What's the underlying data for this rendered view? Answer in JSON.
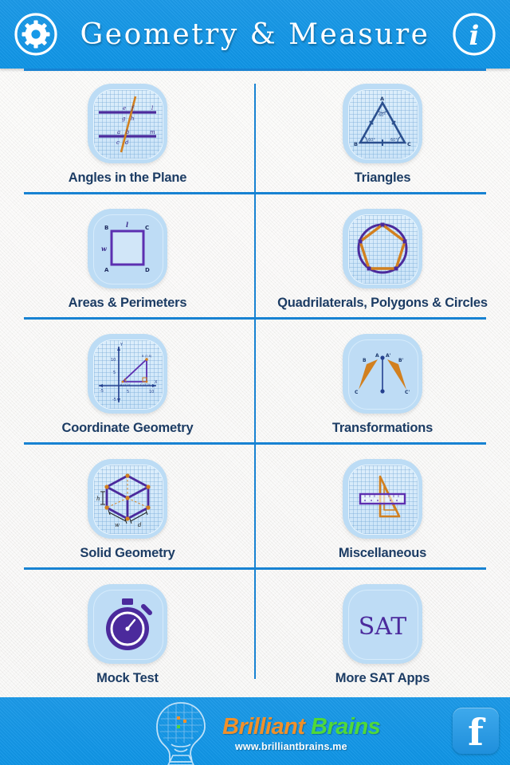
{
  "header": {
    "title": "Geometry  &  Measure",
    "settings_icon": "gear-icon",
    "info_icon": "info-icon"
  },
  "grid": {
    "items": [
      {
        "label": "Angles in the Plane",
        "icon": "parallel-lines-transversal-icon",
        "diagram_labels": [
          "e",
          "f",
          "g",
          "h",
          "a",
          "b",
          "c",
          "d",
          "l",
          "m"
        ]
      },
      {
        "label": "Triangles",
        "icon": "equilateral-triangle-icon",
        "diagram_labels": [
          "A",
          "B",
          "C",
          "60°",
          "60°",
          "60°"
        ]
      },
      {
        "label": "Areas & Perimeters",
        "icon": "rectangle-area-icon",
        "diagram_labels": [
          "A",
          "B",
          "C",
          "D",
          "l",
          "w"
        ]
      },
      {
        "label": "Quadrilaterals, Polygons & Circles",
        "icon": "pentagon-in-circle-icon",
        "diagram_labels": []
      },
      {
        "label": "Coordinate Geometry",
        "icon": "coordinate-plane-triangle-icon",
        "diagram_labels": [
          "X",
          "Y",
          "10",
          "5",
          "-5",
          "-5",
          "5",
          "10",
          "A (1,2)",
          "B (7,8)",
          "C (7,2)"
        ]
      },
      {
        "label": "Transformations",
        "icon": "reflection-triangles-icon",
        "diagram_labels": [
          "A",
          "B",
          "C",
          "A'",
          "B'",
          "C'"
        ]
      },
      {
        "label": "Solid Geometry",
        "icon": "cube-box-icon",
        "diagram_labels": [
          "h",
          "w",
          "d"
        ]
      },
      {
        "label": "Miscellaneous",
        "icon": "ruler-set-square-icon",
        "diagram_labels": []
      },
      {
        "label": "Mock Test",
        "icon": "stopwatch-icon",
        "diagram_labels": []
      },
      {
        "label": "More SAT Apps",
        "icon": "sat-text-icon",
        "diagram_labels": [
          "SAT"
        ]
      }
    ]
  },
  "footer": {
    "brand_word1": "Brilliant",
    "brand_word2": "Brains",
    "url": "www.brilliantbrains.me",
    "brand_icon": "brain-head-logo",
    "facebook_letter": "f",
    "facebook_icon": "facebook-icon"
  },
  "colors": {
    "accent_blue": "#0f95e6",
    "divider_blue": "#1782d2",
    "label_navy": "#1c3c64",
    "tile_blue": "#bcdcf5",
    "purple": "#4b2a9c",
    "orange": "#d2801f",
    "brand_orange": "#f0902a",
    "brand_green": "#4fd83a"
  }
}
